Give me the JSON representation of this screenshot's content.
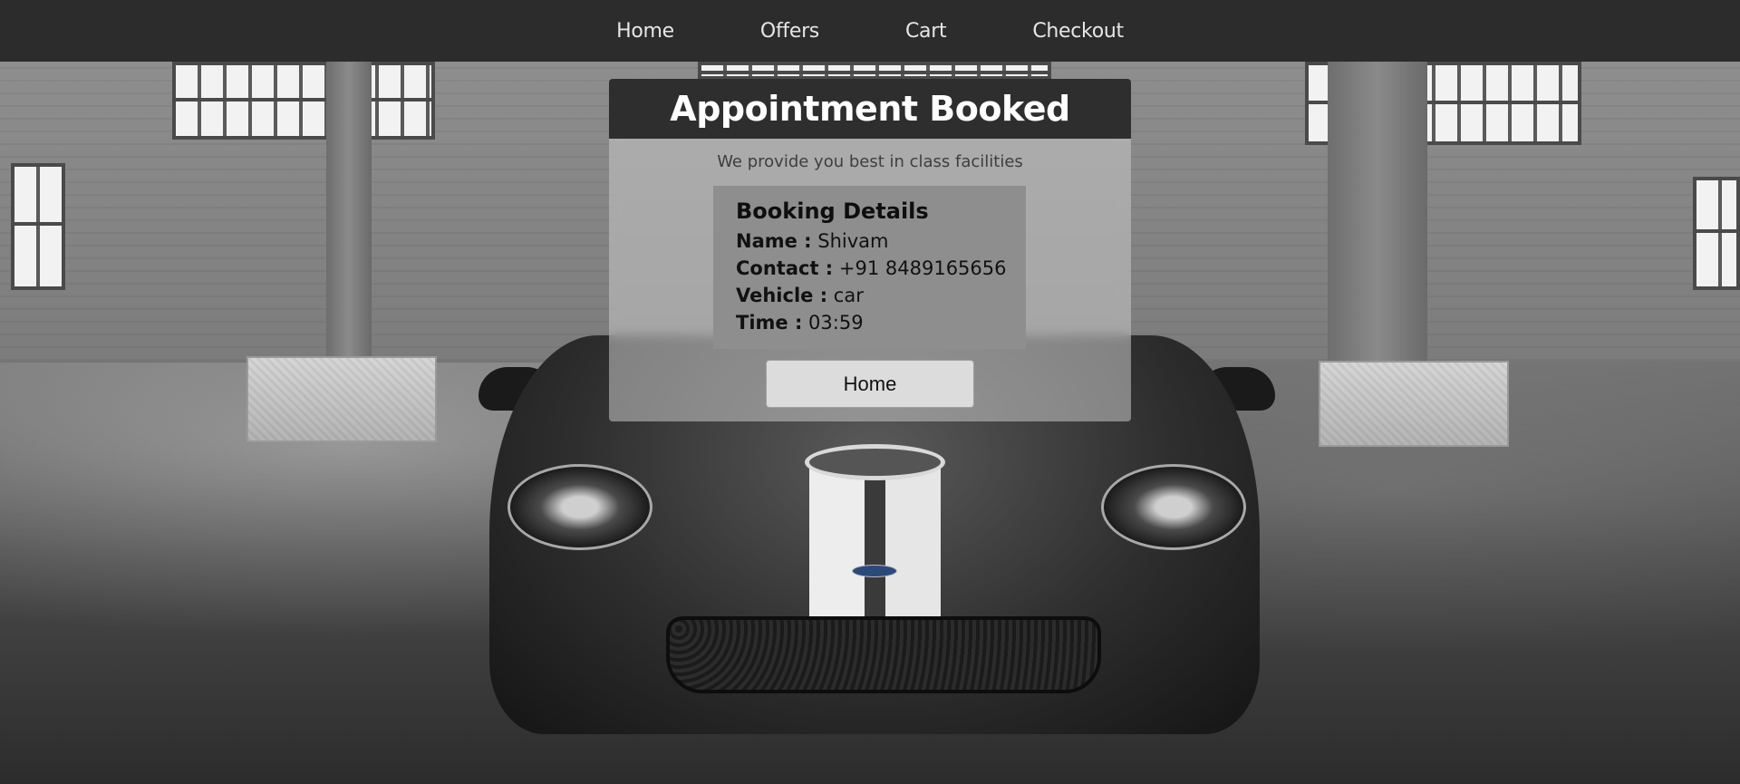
{
  "nav": {
    "items": [
      {
        "label": "Home"
      },
      {
        "label": "Offers"
      },
      {
        "label": "Cart"
      },
      {
        "label": "Checkout"
      }
    ]
  },
  "card": {
    "title": "Appointment Booked",
    "subtitle": "We provide you best in class facilities",
    "details": {
      "heading": "Booking Details",
      "name_label": "Name :",
      "name_value": "Shivam",
      "contact_label": "Contact :",
      "contact_value": "+91 8489165656",
      "vehicle_label": "Vehicle :",
      "vehicle_value": "car",
      "time_label": "Time :",
      "time_value": "03:59"
    },
    "button_label": "Home"
  }
}
